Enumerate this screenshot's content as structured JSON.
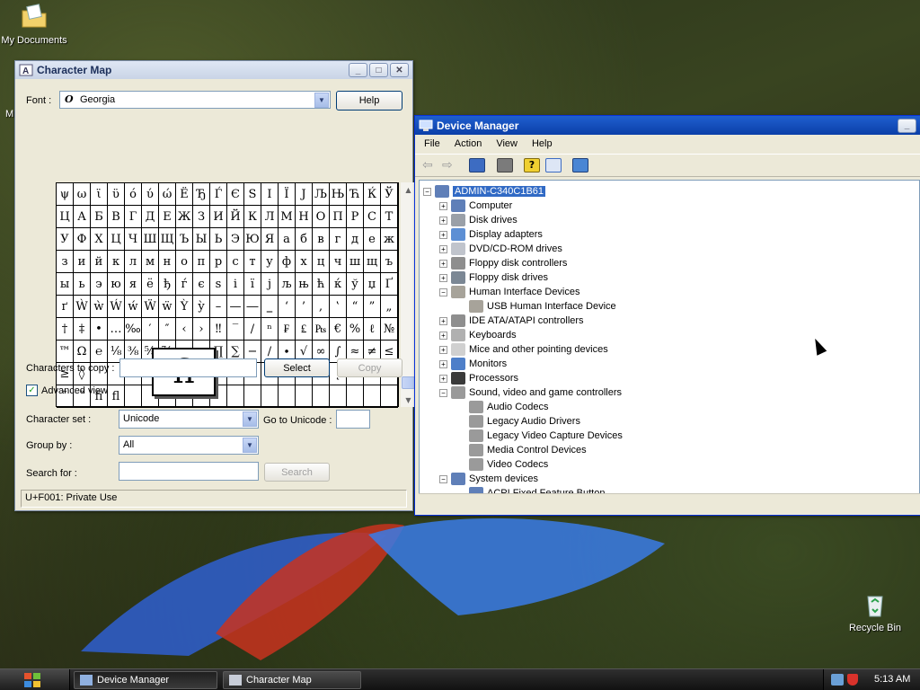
{
  "desktop": {
    "icons": [
      {
        "label": "My Documents"
      },
      {
        "label": "M"
      },
      {
        "label": "Recycle Bin"
      }
    ]
  },
  "charmap": {
    "title": "Character Map",
    "font_label": "Font :",
    "font_value": "Georgia",
    "help_button": "Help",
    "grid_rows": [
      [
        "ψ",
        "ω",
        "ϊ",
        "ϋ",
        "ό",
        "ύ",
        "ώ",
        "Ё",
        "Ђ",
        "Ѓ",
        "Є",
        "Ѕ",
        "І",
        "Ї",
        "Ј",
        "Љ",
        "Њ",
        "Ћ",
        "Ќ",
        "Ў"
      ],
      [
        "Ц",
        "А",
        "Б",
        "В",
        "Г",
        "Д",
        "Е",
        "Ж",
        "З",
        "И",
        "Й",
        "К",
        "Л",
        "М",
        "Н",
        "О",
        "П",
        "Р",
        "С",
        "Т"
      ],
      [
        "У",
        "Ф",
        "Х",
        "Ц",
        "Ч",
        "Ш",
        "Щ",
        "Ъ",
        "Ы",
        "Ь",
        "Э",
        "Ю",
        "Я",
        "а",
        "б",
        "в",
        "г",
        "д",
        "е",
        "ж"
      ],
      [
        "з",
        "и",
        "й",
        "к",
        "л",
        "м",
        "н",
        "о",
        "п",
        "р",
        "с",
        "т",
        "у",
        "ф",
        "х",
        "ц",
        "ч",
        "ш",
        "щ",
        "ъ"
      ],
      [
        "ы",
        "ь",
        "э",
        "ю",
        "я",
        "ё",
        "ђ",
        "ѓ",
        "є",
        "ѕ",
        "і",
        "ї",
        "ј",
        "љ",
        "њ",
        "ћ",
        "ќ",
        "ў",
        "џ",
        "Ґ"
      ],
      [
        "ґ",
        "Ẁ",
        "ẁ",
        "Ẃ",
        "ẃ",
        "Ẅ",
        "ẅ",
        "Ỳ",
        "ỳ",
        "–",
        "—",
        "―",
        "‗",
        "‘",
        "’",
        "‚",
        "‛",
        "“",
        "”",
        "„"
      ],
      [
        "†",
        "‡",
        "•",
        "…",
        "‰",
        "′",
        "″",
        "‹",
        "›",
        "‼",
        "‾",
        "/",
        "ⁿ",
        "₣",
        "₤",
        "₧",
        "€",
        "%",
        "ℓ",
        "№"
      ],
      [
        "™",
        "Ω",
        "℮",
        "⅛",
        "⅜",
        "⅝",
        "⅞",
        "",
        "",
        "∏",
        "∑",
        "−",
        "∕",
        "∙",
        "√",
        "∞",
        "∫",
        "≈",
        "≠",
        "≤"
      ],
      [
        "≥",
        "◊",
        "",
        "",
        "",
        "",
        "",
        "",
        "",
        "",
        "",
        "4",
        "5",
        "7",
        "8",
        "˝",
        "˛",
        "ˋ",
        "˘",
        "˚"
      ],
      [
        "˜",
        "˝",
        "ﬁ",
        "ﬂ",
        "",
        "",
        "",
        "",
        "",
        "",
        "",
        "",
        "",
        "",
        "",
        "",
        "",
        "",
        "",
        ""
      ]
    ],
    "zoom_char": "ﬁ",
    "chars_to_copy_label": "Characters to copy :",
    "chars_to_copy_value": "",
    "select_button": "Select",
    "copy_button": "Copy",
    "advanced_view_label": "Advanced view",
    "advanced_view_checked": true,
    "char_set_label": "Character set :",
    "char_set_value": "Unicode",
    "goto_unicode_label": "Go to Unicode :",
    "goto_unicode_value": "",
    "group_by_label": "Group by :",
    "group_by_value": "All",
    "search_for_label": "Search for :",
    "search_value": "",
    "search_button": "Search",
    "status": "U+F001: Private Use"
  },
  "devmgr": {
    "title": "Device Manager",
    "menu": [
      "File",
      "Action",
      "View",
      "Help"
    ],
    "root": "ADMIN-C340C1B61",
    "tree": [
      {
        "label": "Computer",
        "level": 1,
        "state": "+",
        "icon": "computer-icon"
      },
      {
        "label": "Disk drives",
        "level": 1,
        "state": "+",
        "icon": "disk-drive-icon"
      },
      {
        "label": "Display adapters",
        "level": 1,
        "state": "+",
        "icon": "display-adapter-icon"
      },
      {
        "label": "DVD/CD-ROM drives",
        "level": 1,
        "state": "+",
        "icon": "cdrom-icon"
      },
      {
        "label": "Floppy disk controllers",
        "level": 1,
        "state": "+",
        "icon": "controller-icon"
      },
      {
        "label": "Floppy disk drives",
        "level": 1,
        "state": "+",
        "icon": "floppy-icon"
      },
      {
        "label": "Human Interface Devices",
        "level": 1,
        "state": "-",
        "icon": "hid-icon"
      },
      {
        "label": "USB Human Interface Device",
        "level": 2,
        "state": "",
        "icon": "hid-device-icon"
      },
      {
        "label": "IDE ATA/ATAPI controllers",
        "level": 1,
        "state": "+",
        "icon": "ide-icon"
      },
      {
        "label": "Keyboards",
        "level": 1,
        "state": "+",
        "icon": "keyboard-icon"
      },
      {
        "label": "Mice and other pointing devices",
        "level": 1,
        "state": "+",
        "icon": "mouse-icon"
      },
      {
        "label": "Monitors",
        "level": 1,
        "state": "+",
        "icon": "monitor-icon"
      },
      {
        "label": "Processors",
        "level": 1,
        "state": "+",
        "icon": "processor-icon"
      },
      {
        "label": "Sound, video and game controllers",
        "level": 1,
        "state": "-",
        "icon": "sound-icon"
      },
      {
        "label": "Audio Codecs",
        "level": 2,
        "state": "",
        "icon": "sound-device-icon"
      },
      {
        "label": "Legacy Audio Drivers",
        "level": 2,
        "state": "",
        "icon": "sound-device-icon"
      },
      {
        "label": "Legacy Video Capture Devices",
        "level": 2,
        "state": "",
        "icon": "sound-device-icon"
      },
      {
        "label": "Media Control Devices",
        "level": 2,
        "state": "",
        "icon": "sound-device-icon"
      },
      {
        "label": "Video Codecs",
        "level": 2,
        "state": "",
        "icon": "sound-device-icon"
      },
      {
        "label": "System devices",
        "level": 1,
        "state": "-",
        "icon": "system-icon"
      },
      {
        "label": "ACPI Fixed Feature Button",
        "level": 2,
        "state": "",
        "icon": "system-device-icon"
      }
    ]
  },
  "taskbar": {
    "tasks": [
      "Device Manager",
      "Character Map"
    ],
    "clock": "5:13 AM"
  }
}
